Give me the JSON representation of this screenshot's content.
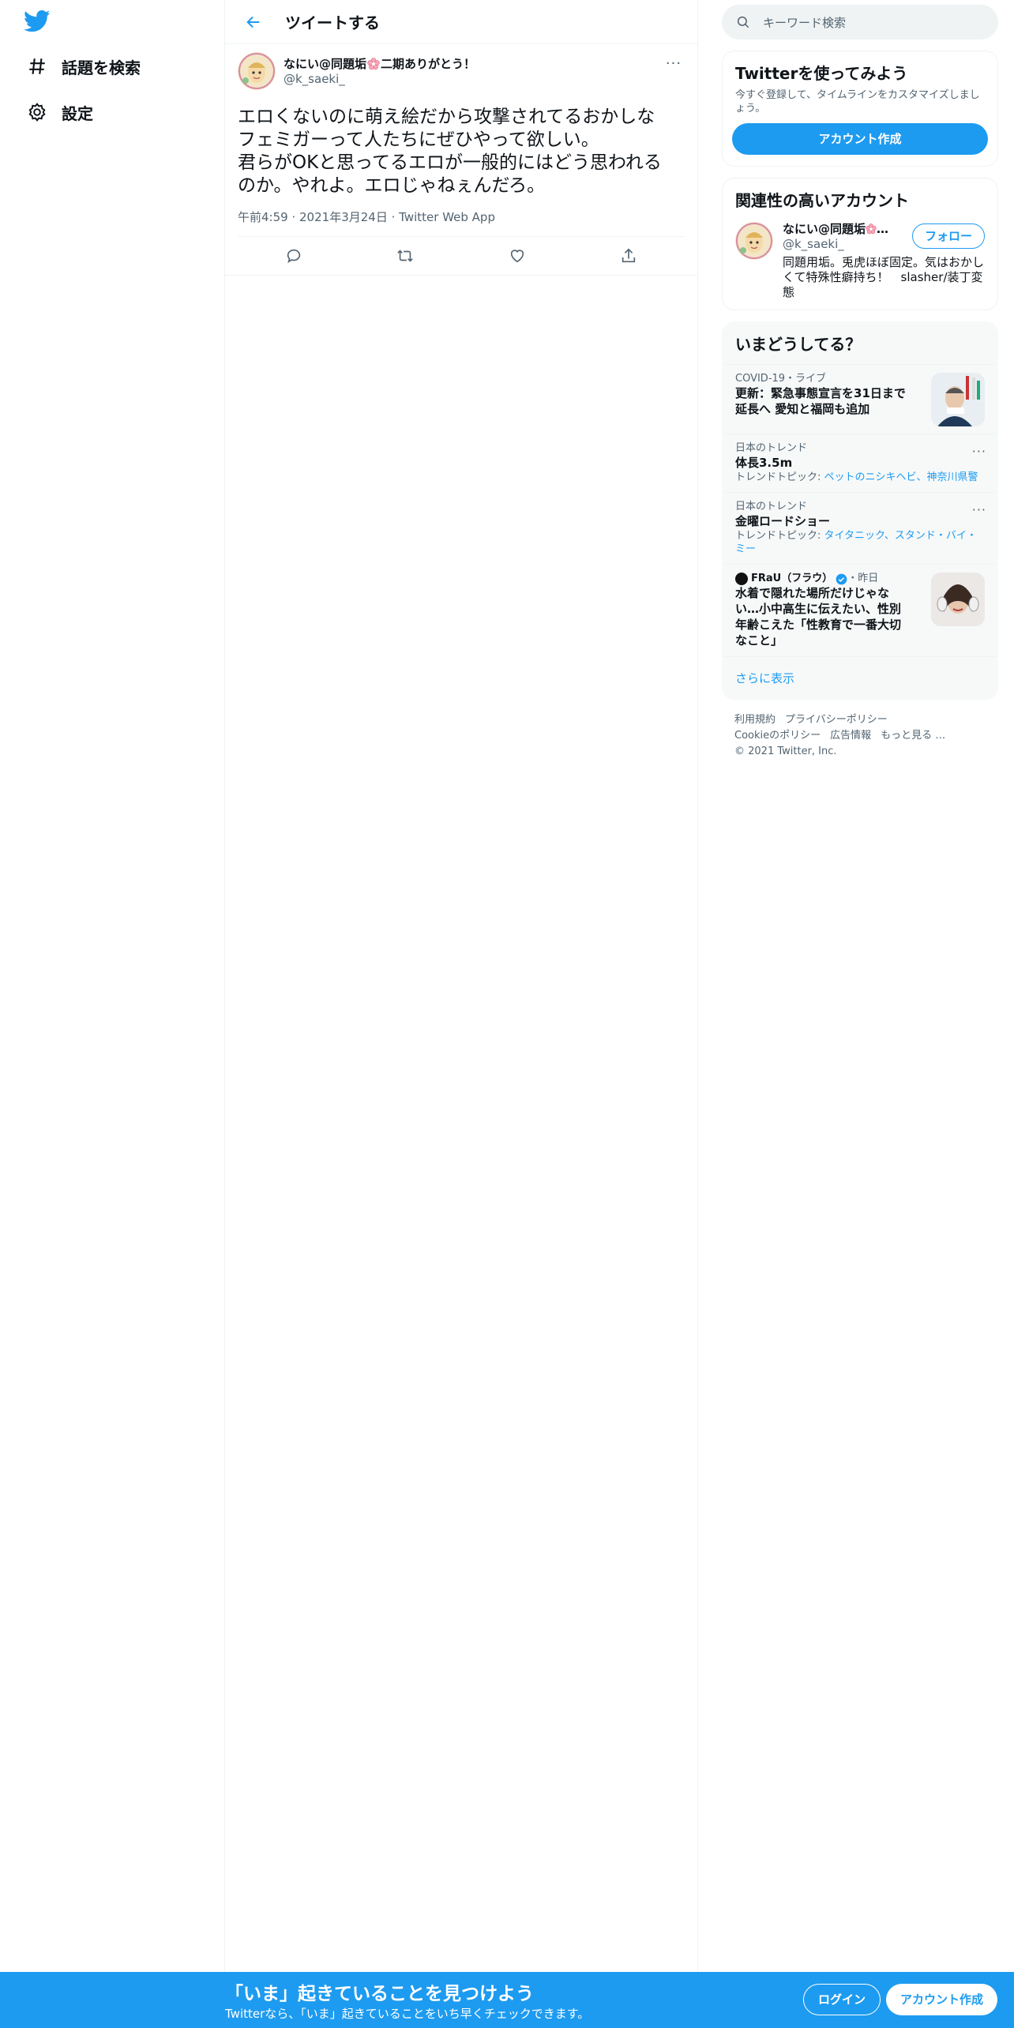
{
  "colors": {
    "accent": "#1d9bf0",
    "text": "#0f1419",
    "muted": "#536471"
  },
  "nav": {
    "items": [
      {
        "icon": "hashtag-icon",
        "label": "話題を検索"
      },
      {
        "icon": "gear-icon",
        "label": "設定"
      }
    ]
  },
  "header": {
    "title": "ツイートする"
  },
  "tweet": {
    "author_name": "なにい@同題垢",
    "author_name_suffix": "二期ありがとう！",
    "author_handle": "@k_saeki_",
    "text": "エロくないのに萌え絵だから攻撃されてるおかしな\nフェミガーって人たちにぜひやって欲しい。\n君らがOKと思ってるエロが一般的にはどう思われる\nのか。やれよ。エロじゃねぇんだろ。",
    "time": "午前4:59",
    "date": "2021年3月24日",
    "source": "Twitter Web App"
  },
  "search": {
    "placeholder": "キーワード検索"
  },
  "signup_card": {
    "title": "Twitterを使ってみよう",
    "desc": "今すぐ登録して、タイムラインをカスタマイズしましょう。",
    "button": "アカウント作成"
  },
  "related": {
    "title": "関連性の高いアカウント",
    "name": "なにい@同題垢",
    "name_suffix": "…",
    "handle": "@k_saeki_",
    "bio": "同題用垢。兎虎ほぼ固定。気はおかしくて特殊性癖持ち！　slasher/装丁変態",
    "follow": "フォロー"
  },
  "trends": {
    "title": "いまどうしてる？",
    "items": [
      {
        "meta": "COVID-19・ライブ",
        "title": "更新：緊急事態宣言を31日まで延長へ 愛知と福岡も追加"
      },
      {
        "meta": "日本のトレンド",
        "title": "体長3.5m",
        "topics_label": "トレンドトピック: ",
        "topics": "ペットのニシキヘビ、神奈川県警"
      },
      {
        "meta": "日本のトレンド",
        "title": "金曜ロードショー",
        "topics_label": "トレンドトピック: ",
        "topics": "タイタニック、スタンド・バイ・ミー"
      },
      {
        "source": "FRaU（フラウ）",
        "when": "・昨日",
        "title": "水着で隠れた場所だけじゃない…小中高生に伝えたい、性別年齢こえた「性教育で一番大切なこと」"
      }
    ],
    "show_more": "さらに表示"
  },
  "footer": {
    "links": [
      "利用規約",
      "プライバシーポリシー",
      "Cookieのポリシー",
      "広告情報",
      "もっと見る …"
    ],
    "copyright": "© 2021 Twitter, Inc."
  },
  "banner": {
    "title": "「いま」起きていることを見つけよう",
    "subtitle": "Twitterなら、「いま」起きていることをいち早くチェックできます。",
    "login": "ログイン",
    "signup": "アカウント作成"
  }
}
